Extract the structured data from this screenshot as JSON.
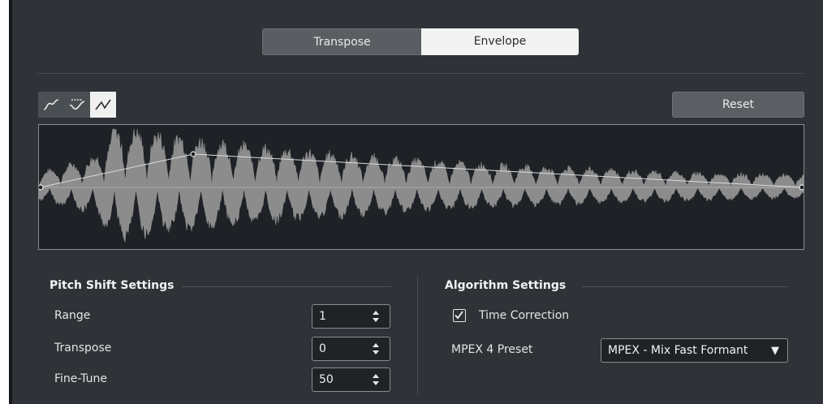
{
  "tabs": {
    "transpose": "Transpose",
    "envelope": "Envelope",
    "active": "Envelope"
  },
  "curve_tools": [
    {
      "icon": "spline-curve-icon",
      "selected": false
    },
    {
      "icon": "damped-spline-icon",
      "selected": false
    },
    {
      "icon": "linear-curve-icon",
      "selected": true
    }
  ],
  "reset_label": "Reset",
  "pitch_shift": {
    "title": "Pitch Shift Settings",
    "range": {
      "label": "Range",
      "value": "1"
    },
    "transpose": {
      "label": "Transpose",
      "value": "0"
    },
    "fine_tune": {
      "label": "Fine-Tune",
      "value": "50"
    }
  },
  "algorithm": {
    "title": "Algorithm Settings",
    "time_correction": {
      "label": "Time Correction",
      "checked": true
    },
    "preset": {
      "label": "MPEX 4 Preset",
      "value": "MPEX - Mix Fast Formant"
    }
  },
  "colors": {
    "background": "#2f3337",
    "waveform": "#8c8c8c",
    "envelope_line": "#dcdcdc",
    "active_tab": "#f3f3f3"
  }
}
